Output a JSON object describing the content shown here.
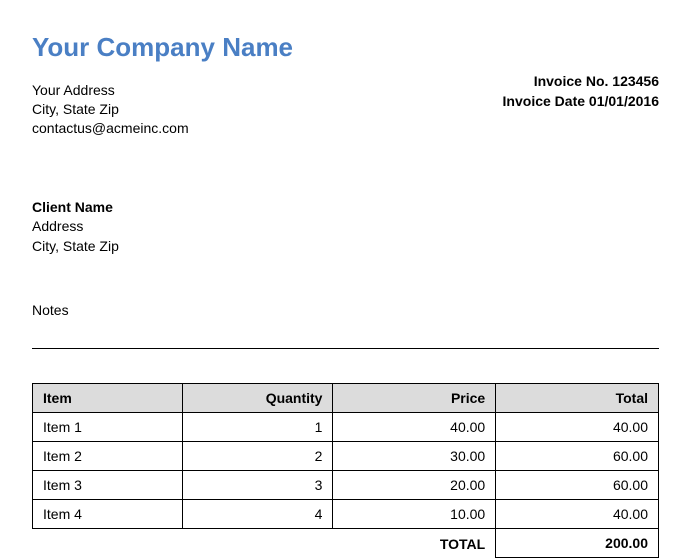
{
  "company": {
    "name": "Your Company Name",
    "address_line1": "Your Address",
    "address_line2": "City, State Zip",
    "email": "contactus@acmeinc.com"
  },
  "invoice": {
    "number_label": "Invoice No.",
    "number": "123456",
    "date_label": "Invoice Date",
    "date": "01/01/2016"
  },
  "client": {
    "name": "Client Name",
    "address_line1": "Address",
    "address_line2": "City, State Zip"
  },
  "notes_label": "Notes",
  "table": {
    "headers": {
      "item": "Item",
      "quantity": "Quantity",
      "price": "Price",
      "total": "Total"
    },
    "rows": [
      {
        "item": "Item 1",
        "quantity": "1",
        "price": "40.00",
        "total": "40.00"
      },
      {
        "item": "Item 2",
        "quantity": "2",
        "price": "30.00",
        "total": "60.00"
      },
      {
        "item": "Item 3",
        "quantity": "3",
        "price": "20.00",
        "total": "60.00"
      },
      {
        "item": "Item 4",
        "quantity": "4",
        "price": "10.00",
        "total": "40.00"
      }
    ],
    "total_label": "TOTAL",
    "grand_total": "200.00"
  }
}
